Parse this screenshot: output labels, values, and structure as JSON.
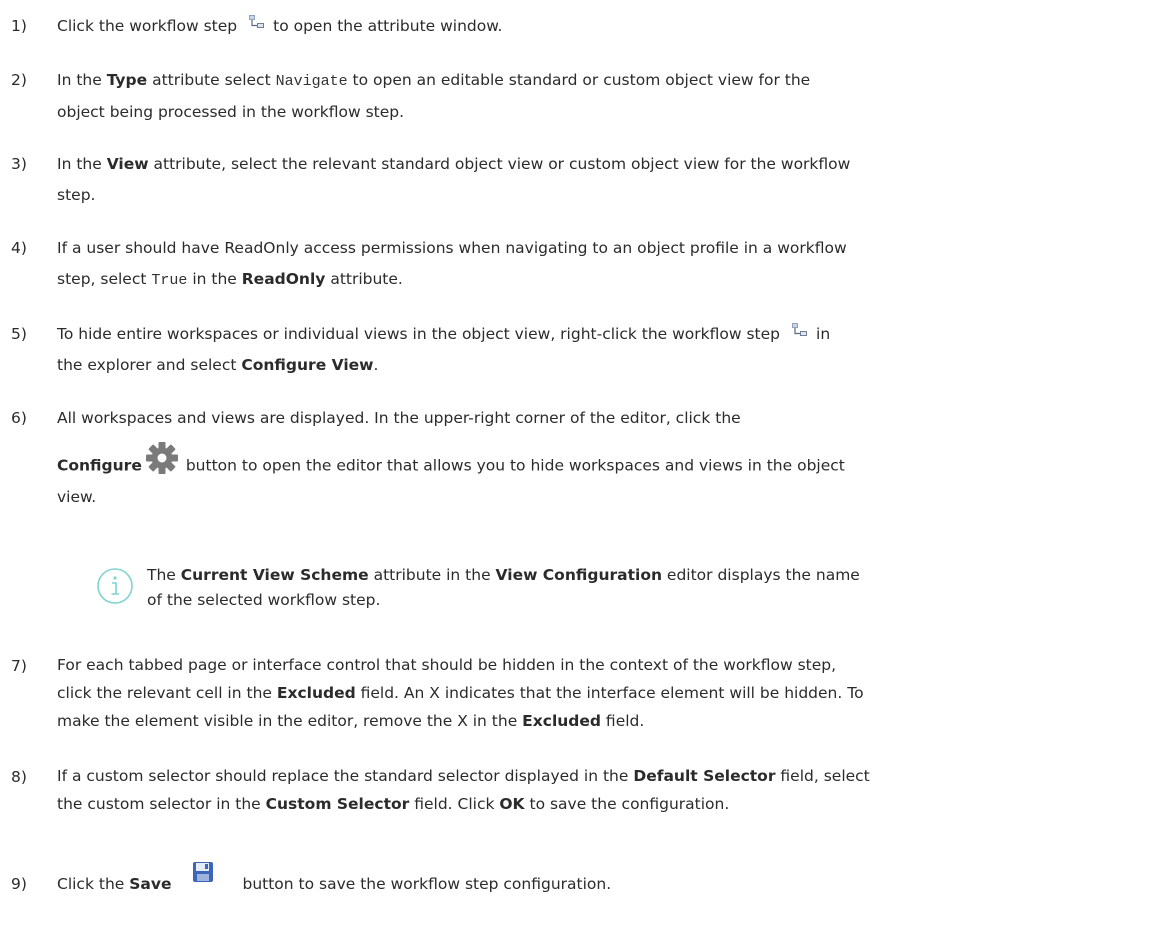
{
  "steps": [
    {
      "num": "1)",
      "a": "Click the workflow step",
      "b": "to open the attribute window."
    },
    {
      "num": "2)",
      "a": "In the ",
      "b1": "Type",
      "c": " attribute select ",
      "code": "Navigate",
      "d": " to open an editable standard or custom object view for the",
      "e": "object being processed in the workflow step."
    },
    {
      "num": "3)",
      "a": "In the ",
      "b1": "View",
      "c": " attribute, select the relevant standard object view or custom object view for the workflow",
      "e": "step."
    },
    {
      "num": "4)",
      "a": "If a user should have ReadOnly access permissions when navigating to an object profile in a workflow",
      "e1": "step, select ",
      "code": "True",
      "e2": " in the ",
      "b1": "ReadOnly",
      "e3": " attribute."
    },
    {
      "num": "5)",
      "a": "To hide entire workspaces or individual views in the object view, right-click the workflow step",
      "a2": "in",
      "e1": "the explorer and select ",
      "b1": "Configure View",
      "e2": "."
    },
    {
      "num": "6)",
      "a": "All workspaces and views are displayed. In the upper-right corner of the editor, click the",
      "b1": "Configure",
      "c": "button to open the editor that allows you to hide workspaces and views in the object",
      "e": "view."
    },
    {
      "num": "7)",
      "a": "For each tabbed page or interface control that should be hidden in the context of the workflow step,",
      "l2a": "click the relevant cell in the ",
      "b1": "Excluded",
      "l2b": " field. An X indicates that the interface element will be hidden. To",
      "l3a": "make the element visible in the editor, remove the X in the ",
      "b2": "Excluded",
      "l3b": " field."
    },
    {
      "num": "8)",
      "a": "If a custom selector should replace the standard selector displayed in the ",
      "b1": "Default Selector",
      "a2": " field, select",
      "l2a": "the custom selector in the ",
      "b2": "Custom Selector",
      "l2b": " field. Click ",
      "b3": "OK",
      "l2c": " to save the configuration."
    },
    {
      "num": "9)",
      "a": "Click the ",
      "b1": "Save",
      "c": "button to save the workflow step configuration."
    }
  ],
  "note": {
    "a": "The ",
    "b1": "Current View Scheme",
    "c": " attribute in the ",
    "b2": "View Configuration",
    "d": " editor displays the name",
    "e": "of the selected workflow step."
  },
  "colors": {
    "text": "#2b2b2b",
    "info": "#7fd3d0",
    "gear": "#7a7a7a",
    "save": "#3d66b8"
  },
  "icons": [
    "workflow-step-icon",
    "gear-icon",
    "info-icon",
    "save-icon"
  ]
}
